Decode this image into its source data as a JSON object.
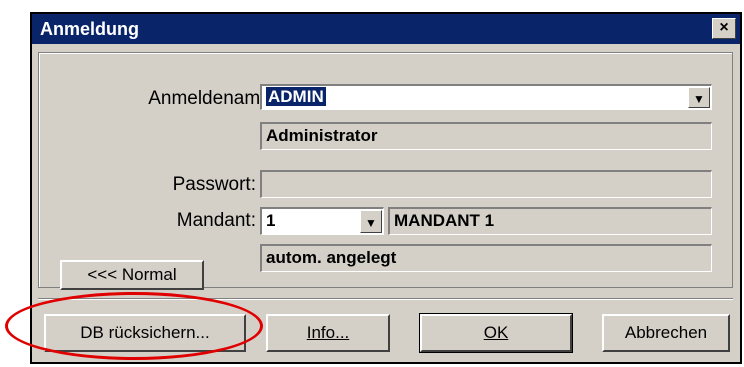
{
  "window": {
    "title": "Anmeldung",
    "close_label": "×"
  },
  "form": {
    "login_label": "Anmeldename:",
    "login_value": "ADMIN",
    "login_fullname": "Administrator",
    "password_label": "Passwort:",
    "password_value": "",
    "mandant_label": "Mandant:",
    "mandant_value": "1",
    "mandant_name": "MANDANT 1",
    "mandant_note": "autom. angelegt"
  },
  "buttons": {
    "normal": "<<< Normal",
    "db_restore": "DB rücksichern...",
    "info": "Info...",
    "ok": "OK",
    "cancel": "Abbrechen"
  },
  "icons": {
    "dropdown": "chevron-down-icon"
  },
  "colors": {
    "titlebar": "#0a246a",
    "dialog_bg": "#d4d0c8",
    "highlight_circle": "#e00000"
  }
}
